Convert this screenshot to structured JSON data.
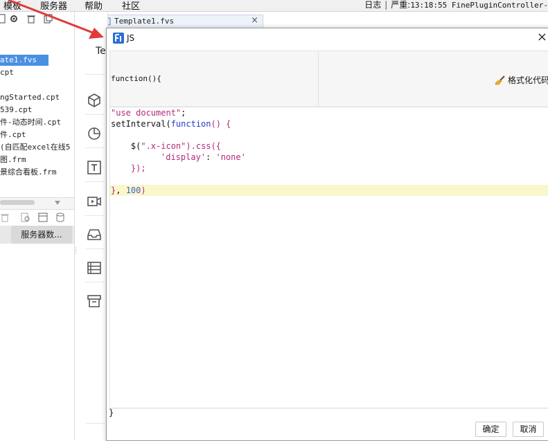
{
  "menubar": {
    "items": [
      "模板",
      "服务器",
      "帮助",
      "社区"
    ],
    "log_label": "日志",
    "severity_label": "严重:",
    "log_message": "13:18:55 FinePluginController-"
  },
  "file_tree": {
    "items": [
      "ate1.fvs",
      "cpt",
      "ngStarted.cpt",
      "539.cpt",
      "件-动态时间.cpt",
      "件.cpt",
      "(自匹配excel在线5",
      "图.frm",
      "景综合看板.frm"
    ],
    "selected_index": 0,
    "bottom_tab": "服务器数..."
  },
  "editor": {
    "tab_title": "Template1.fvs",
    "canvas_fragment": "Te"
  },
  "dialog": {
    "title": "JS",
    "function_signature": "function(){",
    "format_button": "格式化代码",
    "closing_brace": "}",
    "ok_button": "确定",
    "cancel_button": "取消",
    "highlighted_line": 8,
    "code": {
      "l1": "\"use document\"",
      "l1_end": ";",
      "l2_a": "setInterval(",
      "l2_kw": "function",
      "l2_b": "() {",
      "l4_a": "    $(",
      "l4_str": "\".x-icon\"",
      "l4_b": ").css({",
      "l5_key": "'display'",
      "l5_colon": ": ",
      "l5_val": "'none'",
      "l6": "    });",
      "l8_a": "}",
      "l8_b": ", ",
      "l8_num": "100",
      "l8_c": ")"
    }
  },
  "colors": {
    "selection": "#4a90e2",
    "line_highlight": "#fbf7cd",
    "string": "#b22b78",
    "keyword": "#1f3cc8",
    "arrow": "#e23a3a"
  }
}
